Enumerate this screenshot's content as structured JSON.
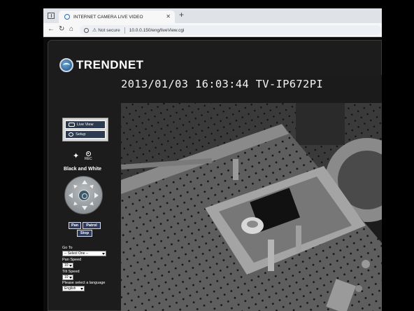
{
  "browser": {
    "tab_title": "INTERNET CAMERA LIVE VIDEO",
    "tab_close": "✕",
    "new_tab": "+",
    "not_secure": "Not secure",
    "url": "10.0.0.150/eng/liveView.cgi",
    "nav": {
      "back": "←",
      "reload": "↻",
      "home": "⌂"
    }
  },
  "camera": {
    "brand": "TRENDNET",
    "menu": {
      "live_view": "Live View",
      "setup": "Setup"
    },
    "rec_label": "REC",
    "mode_label": "Black and White",
    "controls": {
      "pan": "Pan",
      "patrol": "Patrol",
      "stop": "Stop"
    },
    "goto_label": "Go To",
    "goto_value": "-- Select One --",
    "pan_speed_label": "Pan Speed",
    "pan_speed_value": "10",
    "tilt_speed_label": "Tilt Speed",
    "tilt_speed_value": "10",
    "language_label": "Please select a language",
    "language_value": "English",
    "osd_text": "2013/01/03 16:03:44 TV-IP672PI"
  },
  "icons": [
    "window-icon",
    "edge-favicon",
    "back-icon",
    "reload-icon",
    "home-icon",
    "shield-icon",
    "warning-icon",
    "trendnet-logo",
    "live-view-icon",
    "setup-icon",
    "ir-light-icon",
    "rec-icon",
    "ptz-joystick"
  ]
}
